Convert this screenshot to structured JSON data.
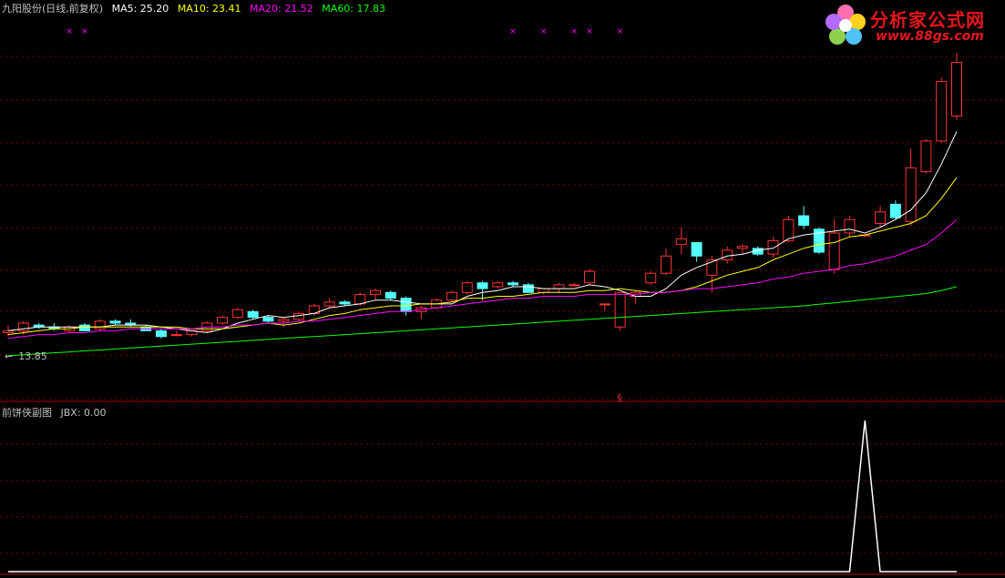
{
  "main_header": {
    "title": "九阳股份(日线,前复权)",
    "ma5": "MA5: 25.20",
    "ma10": "MA10: 23.41",
    "ma20": "MA20: 21.52",
    "ma60": "MA60: 17.83"
  },
  "sub_header": {
    "title": "前饼侠副图",
    "jbx": "JBX: 0.00"
  },
  "price_label": "13.85",
  "logo": {
    "name": "分析家公式网",
    "url": "www.88gs.com"
  },
  "colors": {
    "up": "#ff3232",
    "down": "#54fcfc",
    "ma5": "#ffffff",
    "ma10": "#ffff00",
    "ma20": "#ff00ff",
    "ma60": "#00ff00",
    "grid": "#800000",
    "x_marker": "#ff00ff"
  },
  "chart_data": [
    {
      "type": "candlestick",
      "title": "九阳股份(日线,前复权)",
      "price_axis_min": 12.5,
      "price_axis_max": 28.5,
      "marked_low": 13.85,
      "x_markers_at_candles": [
        4,
        5,
        33,
        35,
        37,
        38,
        40
      ],
      "candles": [
        [
          13.9,
          14.3,
          13.7,
          14.0
        ],
        [
          14.0,
          14.5,
          13.8,
          14.4
        ],
        [
          14.3,
          14.4,
          14.1,
          14.2
        ],
        [
          14.2,
          14.4,
          14.0,
          14.1
        ],
        [
          14.0,
          14.3,
          13.9,
          14.2
        ],
        [
          14.3,
          14.4,
          14.0,
          14.0
        ],
        [
          14.1,
          14.6,
          14.0,
          14.5
        ],
        [
          14.5,
          14.6,
          14.3,
          14.4
        ],
        [
          14.4,
          14.6,
          14.2,
          14.3
        ],
        [
          14.2,
          14.3,
          14.0,
          14.0
        ],
        [
          14.0,
          14.1,
          13.6,
          13.7
        ],
        [
          13.8,
          14.0,
          13.7,
          13.8
        ],
        [
          13.8,
          14.0,
          13.7,
          14.0
        ],
        [
          14.0,
          14.5,
          13.9,
          14.4
        ],
        [
          14.4,
          14.8,
          14.3,
          14.7
        ],
        [
          14.7,
          15.2,
          14.6,
          15.1
        ],
        [
          15.0,
          15.1,
          14.6,
          14.7
        ],
        [
          14.7,
          14.8,
          14.4,
          14.5
        ],
        [
          14.5,
          14.7,
          14.2,
          14.6
        ],
        [
          14.6,
          15.0,
          14.5,
          14.9
        ],
        [
          14.9,
          15.4,
          14.8,
          15.3
        ],
        [
          15.3,
          15.7,
          15.2,
          15.5
        ],
        [
          15.5,
          15.6,
          15.3,
          15.4
        ],
        [
          15.4,
          16.0,
          15.3,
          15.9
        ],
        [
          15.9,
          16.2,
          15.6,
          16.1
        ],
        [
          16.0,
          16.1,
          15.6,
          15.7
        ],
        [
          15.7,
          15.8,
          14.8,
          15.0
        ],
        [
          15.0,
          15.3,
          14.6,
          15.2
        ],
        [
          15.2,
          15.7,
          15.1,
          15.6
        ],
        [
          15.6,
          16.1,
          15.5,
          16.0
        ],
        [
          16.0,
          16.6,
          15.9,
          16.5
        ],
        [
          16.5,
          16.6,
          15.6,
          16.2
        ],
        [
          16.3,
          16.6,
          16.2,
          16.5
        ],
        [
          16.5,
          16.6,
          16.3,
          16.4
        ],
        [
          16.4,
          16.5,
          16.1,
          16.0
        ],
        [
          16.0,
          16.2,
          15.9,
          16.2
        ],
        [
          16.2,
          16.5,
          16.0,
          16.4
        ],
        [
          16.4,
          16.5,
          16.3,
          16.4
        ],
        [
          16.5,
          17.2,
          16.4,
          17.1
        ],
        [
          15.4,
          15.4,
          15.0,
          15.4
        ],
        [
          14.2,
          16.0,
          14.0,
          16.0
        ],
        [
          15.8,
          16.1,
          15.4,
          16.0
        ],
        [
          16.5,
          17.1,
          16.4,
          17.0
        ],
        [
          17.0,
          18.3,
          16.9,
          17.9
        ],
        [
          18.5,
          19.4,
          18.0,
          18.8
        ],
        [
          18.6,
          18.6,
          17.6,
          17.9
        ],
        [
          16.9,
          17.9,
          16.0,
          17.7
        ],
        [
          17.7,
          18.4,
          17.5,
          18.2
        ],
        [
          18.3,
          18.5,
          18.0,
          18.4
        ],
        [
          18.3,
          18.4,
          17.9,
          18.0
        ],
        [
          18.0,
          18.9,
          17.8,
          18.7
        ],
        [
          18.7,
          20.0,
          18.6,
          19.8
        ],
        [
          20.0,
          20.5,
          19.3,
          19.5
        ],
        [
          19.3,
          19.4,
          18.0,
          18.1
        ],
        [
          17.2,
          19.8,
          17.0,
          19.1
        ],
        [
          19.1,
          20.0,
          18.9,
          19.8
        ],
        [
          19.0,
          19.0,
          18.9,
          19.0
        ],
        [
          19.6,
          20.5,
          19.4,
          20.2
        ],
        [
          20.6,
          20.8,
          19.8,
          19.9
        ],
        [
          19.7,
          23.5,
          19.5,
          22.5
        ],
        [
          22.3,
          24.0,
          22.2,
          23.9
        ],
        [
          23.9,
          27.2,
          23.8,
          27.0
        ],
        [
          25.2,
          28.5,
          25.0,
          28.0
        ]
      ],
      "series": [
        {
          "name": "MA5",
          "values": [
            14.0,
            14.1,
            14.2,
            14.2,
            14.2,
            14.2,
            14.2,
            14.3,
            14.3,
            14.3,
            14.2,
            14.1,
            14.0,
            13.9,
            14.1,
            14.4,
            14.6,
            14.8,
            14.7,
            14.8,
            14.9,
            15.2,
            15.3,
            15.4,
            15.6,
            15.6,
            15.5,
            15.4,
            15.4,
            15.4,
            15.8,
            16.0,
            16.1,
            16.3,
            16.3,
            16.2,
            16.2,
            16.2,
            16.4,
            16.3,
            16.1,
            15.8,
            15.8,
            16.2,
            16.9,
            17.3,
            17.6,
            17.9,
            18.0,
            18.2,
            18.3,
            18.8,
            19.0,
            19.1,
            19.2,
            19.3,
            19.1,
            19.4,
            19.8,
            20.3,
            21.2,
            22.7,
            24.4
          ]
        },
        {
          "name": "MA10",
          "values": [
            13.8,
            13.9,
            14.0,
            14.1,
            14.1,
            14.2,
            14.2,
            14.2,
            14.2,
            14.2,
            14.2,
            14.2,
            14.1,
            14.1,
            14.1,
            14.2,
            14.3,
            14.4,
            14.3,
            14.4,
            14.6,
            14.8,
            14.9,
            15.1,
            15.2,
            15.3,
            15.3,
            15.4,
            15.4,
            15.5,
            15.7,
            15.7,
            15.8,
            15.8,
            15.9,
            16.0,
            16.0,
            16.0,
            16.1,
            16.1,
            16.2,
            16.1,
            16.0,
            16.0,
            16.1,
            16.3,
            16.6,
            16.9,
            17.1,
            17.3,
            17.7,
            18.0,
            18.3,
            18.5,
            18.6,
            18.9,
            19.0,
            19.2,
            19.4,
            19.6,
            20.0,
            20.9,
            22.0
          ]
        },
        {
          "name": "MA20",
          "values": [
            13.6,
            13.7,
            13.8,
            13.8,
            13.9,
            13.9,
            14.0,
            14.0,
            14.1,
            14.1,
            14.1,
            14.1,
            14.1,
            14.2,
            14.2,
            14.3,
            14.3,
            14.4,
            14.4,
            14.5,
            14.5,
            14.6,
            14.7,
            14.8,
            14.9,
            15.0,
            15.0,
            15.1,
            15.2,
            15.3,
            15.4,
            15.5,
            15.6,
            15.7,
            15.7,
            15.8,
            15.8,
            15.8,
            15.9,
            15.9,
            15.9,
            15.9,
            16.0,
            16.0,
            16.1,
            16.2,
            16.2,
            16.3,
            16.4,
            16.5,
            16.7,
            16.8,
            17.0,
            17.1,
            17.2,
            17.4,
            17.5,
            17.7,
            17.9,
            18.2,
            18.5,
            19.1,
            19.8
          ]
        },
        {
          "name": "MA60",
          "values": [
            12.7,
            12.75,
            12.8,
            12.85,
            12.9,
            12.95,
            13.0,
            13.05,
            13.1,
            13.15,
            13.2,
            13.25,
            13.3,
            13.35,
            13.4,
            13.45,
            13.5,
            13.55,
            13.6,
            13.65,
            13.7,
            13.75,
            13.8,
            13.85,
            13.9,
            13.95,
            14.0,
            14.05,
            14.1,
            14.15,
            14.2,
            14.25,
            14.3,
            14.35,
            14.4,
            14.45,
            14.5,
            14.55,
            14.6,
            14.65,
            14.7,
            14.75,
            14.8,
            14.85,
            14.9,
            14.95,
            15.0,
            15.05,
            15.1,
            15.15,
            15.2,
            15.25,
            15.3,
            15.38,
            15.46,
            15.54,
            15.62,
            15.7,
            15.78,
            15.86,
            15.94,
            16.1,
            16.3
          ]
        }
      ]
    },
    {
      "type": "line",
      "title": "前饼侠副图",
      "series": [
        {
          "name": "JBX",
          "values": [
            0,
            0,
            0,
            0,
            0,
            0,
            0,
            0,
            0,
            0,
            0,
            0,
            0,
            0,
            0,
            0,
            0,
            0,
            0,
            0,
            0,
            0,
            0,
            0,
            0,
            0,
            0,
            0,
            0,
            0,
            0,
            0,
            0,
            0,
            0,
            0,
            0,
            0,
            0,
            0,
            0,
            0,
            0,
            0,
            0,
            0,
            0,
            0,
            0,
            0,
            0,
            0,
            0,
            0,
            0,
            0,
            1,
            0,
            0,
            0,
            0,
            0,
            0
          ]
        }
      ],
      "ylim": [
        0,
        1
      ]
    }
  ]
}
